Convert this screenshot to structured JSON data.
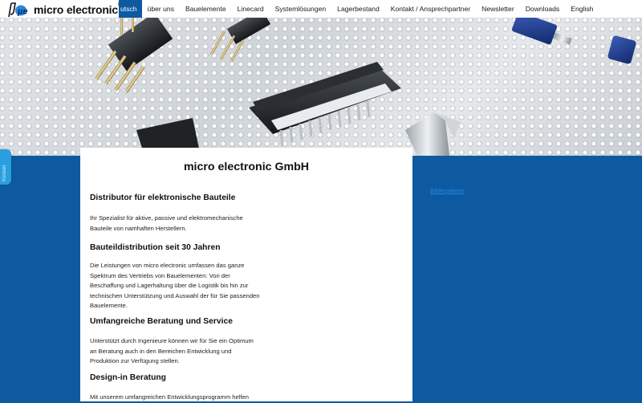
{
  "brand": {
    "logo_mark": "µe",
    "name": "micro electronic",
    "registered": "®"
  },
  "nav": {
    "items": [
      {
        "label": "utsch",
        "active": true
      },
      {
        "label": "über uns"
      },
      {
        "label": "Bauelemente"
      },
      {
        "label": "Linecard"
      },
      {
        "label": "Systemlösungen"
      },
      {
        "label": "Lagerbestand"
      },
      {
        "label": "Kontakt / Ansprechpartner"
      },
      {
        "label": "Newsletter"
      },
      {
        "label": "Downloads"
      },
      {
        "label": "English"
      }
    ]
  },
  "side_tab": {
    "label": "Kontakt"
  },
  "gallery_link": {
    "label": "Bildergalerie"
  },
  "content": {
    "title": "micro electronic GmbH",
    "sections": [
      {
        "heading": "Distributor für elektronische Bauteile",
        "lines": [
          "Ihr Spezialist für aktive, passive und elektromechanische",
          "Bauteile von namhaften Herstellern."
        ]
      },
      {
        "heading": "Bauteildistribution seit 30 Jahren",
        "lines": [
          "Die Leistungen von micro electronic umfassen das ganze",
          "Spektrum des Vertriebs von Bauelementen: Von der",
          "Beschaffung und Lagerhaltung über die Logistik bis hin zur",
          "technischen Unterstützung und Auswahl der für Sie passenden",
          "Bauelemente."
        ]
      },
      {
        "heading": "Umfangreiche Beratung und Service",
        "lines": [
          "Unterstützt durch Ingenieure können wir für Sie ein Optimum",
          "an Beratung auch in den Bereichen Entwicklung und",
          "Produktion zur Verfügung stellen."
        ]
      },
      {
        "heading": "Design-in Beratung",
        "lines": [
          "Mit unserem umfangreichen Entwicklungsprogramm helfen"
        ]
      }
    ]
  },
  "colors": {
    "brand_blue": "#0d5aa0",
    "side_tab": "#2a9fe0",
    "link": "#2a86e0"
  }
}
